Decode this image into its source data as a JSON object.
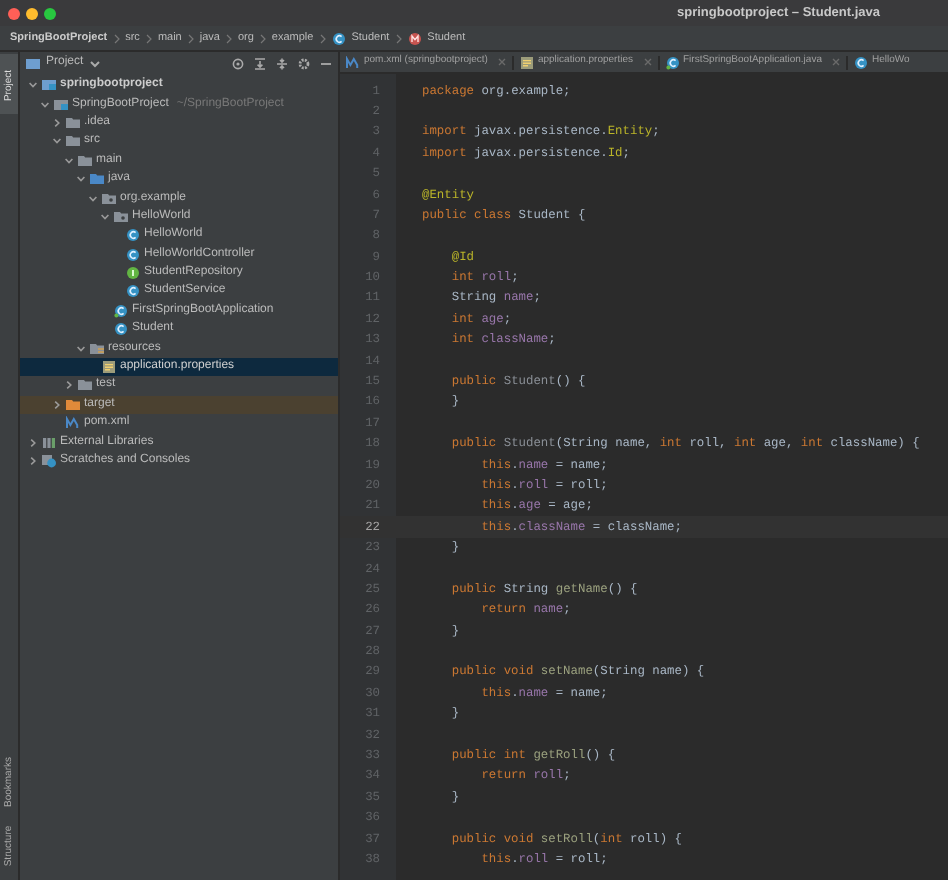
{
  "window": {
    "title": "springbootproject – Student.java"
  },
  "breadcrumbs": [
    {
      "text": "SpringBootProject",
      "kind": "project"
    },
    {
      "text": "src",
      "kind": "plain"
    },
    {
      "text": "main",
      "kind": "plain"
    },
    {
      "text": "java",
      "kind": "plain"
    },
    {
      "text": "org",
      "kind": "plain"
    },
    {
      "text": "example",
      "kind": "plain"
    },
    {
      "text": "Student",
      "kind": "class"
    },
    {
      "text": "Student",
      "kind": "method"
    }
  ],
  "side_strip": {
    "top": "Project",
    "bottom": [
      "Structure",
      "Bookmarks"
    ]
  },
  "project_panel": {
    "title": "Project",
    "tree": [
      {
        "label": "springbootproject",
        "kind": "project",
        "expanded": true,
        "selected": false,
        "children": [
          {
            "label": "SpringBootProject",
            "note": "~/SpringBootProject",
            "kind": "module",
            "expanded": true,
            "selected": false,
            "children": [
              {
                "label": ".idea",
                "kind": "folder",
                "expanded": false,
                "selected": false
              },
              {
                "label": "src",
                "kind": "folder",
                "expanded": true,
                "selected": false,
                "children": [
                  {
                    "label": "main",
                    "kind": "folder",
                    "expanded": true,
                    "selected": false,
                    "children": [
                      {
                        "label": "java",
                        "kind": "source-folder",
                        "expanded": true,
                        "selected": false,
                        "children": [
                          {
                            "label": "org.example",
                            "kind": "package",
                            "expanded": true,
                            "selected": false,
                            "children": [
                              {
                                "label": "HelloWorld",
                                "kind": "package",
                                "expanded": true,
                                "selected": false,
                                "children": [
                                  {
                                    "label": "HelloWorld",
                                    "kind": "class",
                                    "selected": false
                                  },
                                  {
                                    "label": "HelloWorldController",
                                    "kind": "class",
                                    "selected": false
                                  },
                                  {
                                    "label": "StudentRepository",
                                    "kind": "interface",
                                    "selected": false
                                  },
                                  {
                                    "label": "StudentService",
                                    "kind": "class",
                                    "selected": false
                                  }
                                ]
                              },
                              {
                                "label": "FirstSpringBootApplication",
                                "kind": "spring-class",
                                "selected": false
                              },
                              {
                                "label": "Student",
                                "kind": "class",
                                "selected": false
                              }
                            ]
                          }
                        ]
                      },
                      {
                        "label": "resources",
                        "kind": "resources-folder",
                        "expanded": true,
                        "selected": false,
                        "children": [
                          {
                            "label": "application.properties",
                            "kind": "properties",
                            "selected": true
                          }
                        ]
                      }
                    ]
                  },
                  {
                    "label": "test",
                    "kind": "folder",
                    "expanded": false,
                    "selected": false
                  }
                ]
              },
              {
                "label": "target",
                "kind": "excluded-folder",
                "expanded": false,
                "selected": false
              },
              {
                "label": "pom.xml",
                "kind": "maven",
                "selected": false
              }
            ]
          }
        ]
      },
      {
        "label": "External Libraries",
        "kind": "libraries",
        "expanded": false,
        "selected": false
      },
      {
        "label": "Scratches and Consoles",
        "kind": "scratches",
        "expanded": false,
        "selected": false
      }
    ]
  },
  "editor_tabs": [
    {
      "label": "pom.xml (springbootproject)",
      "kind": "maven",
      "selected": false,
      "closable": true
    },
    {
      "label": "application.properties",
      "kind": "properties",
      "selected": false,
      "closable": true
    },
    {
      "label": "FirstSpringBootApplication.java",
      "kind": "spring-class",
      "selected": false,
      "closable": true
    },
    {
      "label": "HelloWo",
      "kind": "class",
      "selected": false,
      "closable": false
    }
  ],
  "editor": {
    "lines": [
      {
        "number": "1",
        "current": false,
        "tokens": [
          {
            "text": "package",
            "kind": "keyword"
          },
          {
            "text": " org.example;",
            "kind": "plain"
          }
        ]
      },
      {
        "number": "2",
        "current": false
      },
      {
        "number": "3",
        "current": false,
        "tokens": [
          {
            "text": "import",
            "kind": "keyword"
          },
          {
            "text": " javax.persistence.",
            "kind": "plain"
          },
          {
            "text": "Entity",
            "kind": "annotation"
          },
          {
            "text": ";",
            "kind": "plain"
          }
        ]
      },
      {
        "number": "4",
        "current": false,
        "tokens": [
          {
            "text": "import",
            "kind": "keyword"
          },
          {
            "text": " javax.persistence.",
            "kind": "plain"
          },
          {
            "text": "Id",
            "kind": "annotation"
          },
          {
            "text": ";",
            "kind": "plain"
          }
        ]
      },
      {
        "number": "5",
        "current": false
      },
      {
        "number": "6",
        "current": false,
        "tokens": [
          {
            "text": "@Entity",
            "kind": "annotation"
          }
        ]
      },
      {
        "number": "7",
        "current": false,
        "tokens": [
          {
            "text": "public class",
            "kind": "keyword"
          },
          {
            "text": " Student {",
            "kind": "plain"
          }
        ]
      },
      {
        "number": "8",
        "current": false
      },
      {
        "number": "9",
        "current": false,
        "tokens": [
          {
            "text": "    @Id",
            "kind": "annotation"
          }
        ]
      },
      {
        "number": "10",
        "current": false,
        "tokens": [
          {
            "text": "    int",
            "kind": "keyword"
          },
          {
            "text": " roll",
            "kind": "field"
          },
          {
            "text": ";",
            "kind": "plain"
          }
        ]
      },
      {
        "number": "11",
        "current": false,
        "tokens": [
          {
            "text": "    String",
            "kind": "plain"
          },
          {
            "text": " name",
            "kind": "field"
          },
          {
            "text": ";",
            "kind": "plain"
          }
        ]
      },
      {
        "number": "12",
        "current": false,
        "tokens": [
          {
            "text": "    int",
            "kind": "keyword"
          },
          {
            "text": " age",
            "kind": "field"
          },
          {
            "text": ";",
            "kind": "plain"
          }
        ]
      },
      {
        "number": "13",
        "current": false,
        "tokens": [
          {
            "text": "    int",
            "kind": "keyword"
          },
          {
            "text": " className",
            "kind": "field"
          },
          {
            "text": ";",
            "kind": "plain"
          }
        ]
      },
      {
        "number": "14",
        "current": false
      },
      {
        "number": "15",
        "current": false,
        "tokens": [
          {
            "text": "    public",
            "kind": "keyword"
          },
          {
            "text": " Student",
            "kind": "unused"
          },
          {
            "text": "() {",
            "kind": "plain"
          }
        ]
      },
      {
        "number": "16",
        "current": false,
        "tokens": [
          {
            "text": "    }",
            "kind": "plain"
          }
        ]
      },
      {
        "number": "17",
        "current": false
      },
      {
        "number": "18",
        "current": false,
        "tokens": [
          {
            "text": "    public",
            "kind": "keyword"
          },
          {
            "text": " Student",
            "kind": "unused"
          },
          {
            "text": "(String name, ",
            "kind": "plain"
          },
          {
            "text": "int",
            "kind": "keyword"
          },
          {
            "text": " roll, ",
            "kind": "plain"
          },
          {
            "text": "int",
            "kind": "keyword"
          },
          {
            "text": " age, ",
            "kind": "plain"
          },
          {
            "text": "int",
            "kind": "keyword"
          },
          {
            "text": " className) {",
            "kind": "plain"
          }
        ]
      },
      {
        "number": "19",
        "current": false,
        "tokens": [
          {
            "text": "        this",
            "kind": "keyword"
          },
          {
            "text": ".",
            "kind": "plain"
          },
          {
            "text": "name",
            "kind": "field"
          },
          {
            "text": " = name;",
            "kind": "plain"
          }
        ]
      },
      {
        "number": "20",
        "current": false,
        "tokens": [
          {
            "text": "        this",
            "kind": "keyword"
          },
          {
            "text": ".",
            "kind": "plain"
          },
          {
            "text": "roll",
            "kind": "field"
          },
          {
            "text": " = roll;",
            "kind": "plain"
          }
        ]
      },
      {
        "number": "21",
        "current": false,
        "tokens": [
          {
            "text": "        this",
            "kind": "keyword"
          },
          {
            "text": ".",
            "kind": "plain"
          },
          {
            "text": "age",
            "kind": "field"
          },
          {
            "text": " = age;",
            "kind": "plain"
          }
        ]
      },
      {
        "number": "22",
        "current": true,
        "tokens": [
          {
            "text": "        this",
            "kind": "keyword"
          },
          {
            "text": ".",
            "kind": "plain"
          },
          {
            "text": "className",
            "kind": "field"
          },
          {
            "text": " = className;",
            "kind": "plain"
          }
        ]
      },
      {
        "number": "23",
        "current": false,
        "tokens": [
          {
            "text": "    }",
            "kind": "plain"
          }
        ]
      },
      {
        "number": "24",
        "current": false
      },
      {
        "number": "25",
        "current": false,
        "tokens": [
          {
            "text": "    public",
            "kind": "keyword"
          },
          {
            "text": " String ",
            "kind": "plain"
          },
          {
            "text": "getName",
            "kind": "method"
          },
          {
            "text": "() {",
            "kind": "plain"
          }
        ]
      },
      {
        "number": "26",
        "current": false,
        "tokens": [
          {
            "text": "        return",
            "kind": "keyword"
          },
          {
            "text": " name",
            "kind": "field"
          },
          {
            "text": ";",
            "kind": "plain"
          }
        ]
      },
      {
        "number": "27",
        "current": false,
        "tokens": [
          {
            "text": "    }",
            "kind": "plain"
          }
        ]
      },
      {
        "number": "28",
        "current": false
      },
      {
        "number": "29",
        "current": false,
        "tokens": [
          {
            "text": "    public void",
            "kind": "keyword"
          },
          {
            "text": " setName",
            "kind": "method"
          },
          {
            "text": "(String name) {",
            "kind": "plain"
          }
        ]
      },
      {
        "number": "30",
        "current": false,
        "tokens": [
          {
            "text": "        this",
            "kind": "keyword"
          },
          {
            "text": ".",
            "kind": "plain"
          },
          {
            "text": "name",
            "kind": "field"
          },
          {
            "text": " = name;",
            "kind": "plain"
          }
        ]
      },
      {
        "number": "31",
        "current": false,
        "tokens": [
          {
            "text": "    }",
            "kind": "plain"
          }
        ]
      },
      {
        "number": "32",
        "current": false
      },
      {
        "number": "33",
        "current": false,
        "tokens": [
          {
            "text": "    public int",
            "kind": "keyword"
          },
          {
            "text": " getRoll",
            "kind": "method"
          },
          {
            "text": "() {",
            "kind": "plain"
          }
        ]
      },
      {
        "number": "34",
        "current": false,
        "tokens": [
          {
            "text": "        return",
            "kind": "keyword"
          },
          {
            "text": " roll",
            "kind": "field"
          },
          {
            "text": ";",
            "kind": "plain"
          }
        ]
      },
      {
        "number": "35",
        "current": false,
        "tokens": [
          {
            "text": "    }",
            "kind": "plain"
          }
        ]
      },
      {
        "number": "36",
        "current": false
      },
      {
        "number": "37",
        "current": false,
        "tokens": [
          {
            "text": "    public void",
            "kind": "keyword"
          },
          {
            "text": " setRoll",
            "kind": "method"
          },
          {
            "text": "(",
            "kind": "plain"
          },
          {
            "text": "int",
            "kind": "keyword"
          },
          {
            "text": " roll) {",
            "kind": "plain"
          }
        ]
      },
      {
        "number": "38",
        "current": false,
        "tokens": [
          {
            "text": "        this",
            "kind": "keyword"
          },
          {
            "text": ".",
            "kind": "plain"
          },
          {
            "text": "roll",
            "kind": "field"
          },
          {
            "text": " = roll;",
            "kind": "plain"
          }
        ]
      }
    ]
  }
}
